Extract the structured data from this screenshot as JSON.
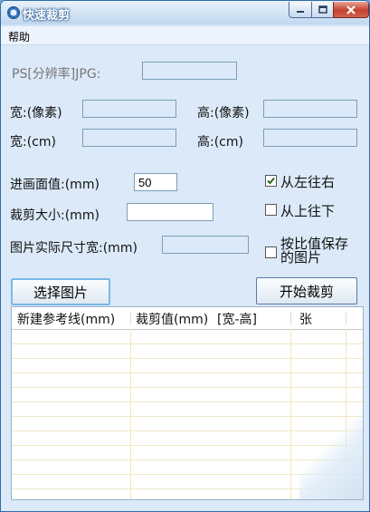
{
  "window": {
    "title": "快速裁剪",
    "icon": "gear-icon",
    "minimize_icon": "minimize-icon",
    "maximize_icon": "maximize-icon",
    "close_icon": "close-icon"
  },
  "menu": {
    "help": "帮助"
  },
  "form": {
    "ps_label": "PS[分辨率]JPG:",
    "ps_value": "",
    "width_px_label": "宽:(像素)",
    "width_px_value": "",
    "height_px_label": "高:(像素)",
    "height_px_value": "",
    "width_cm_label": "宽:(cm)",
    "width_cm_value": "",
    "height_cm_label": "高:(cm)",
    "height_cm_value": "",
    "feed_label": "进画面值:(mm)",
    "feed_value": "50",
    "crop_size_label": "裁剪大小:(mm)",
    "crop_size_value": "",
    "actual_width_label": "图片实际尺寸宽:(mm)",
    "actual_width_value": ""
  },
  "options": {
    "left_to_right": {
      "label": "从左往右",
      "checked": true
    },
    "top_to_bottom": {
      "label": "从上往下",
      "checked": false
    },
    "save_by_ratio": {
      "label_line1": "按比值保存",
      "label_line2": "的图片",
      "checked": false
    }
  },
  "buttons": {
    "select_image": "选择图片",
    "start_crop": "开始裁剪"
  },
  "table": {
    "columns": [
      "新建参考线(mm)",
      "裁剪值(mm)",
      "[宽-高]",
      "张"
    ],
    "rows": []
  },
  "colors": {
    "title_bar": "#c2d8ef",
    "client_bg": "#dbe9f8",
    "close_button": "#c4422e",
    "grid_line": "#f0e7c6"
  }
}
